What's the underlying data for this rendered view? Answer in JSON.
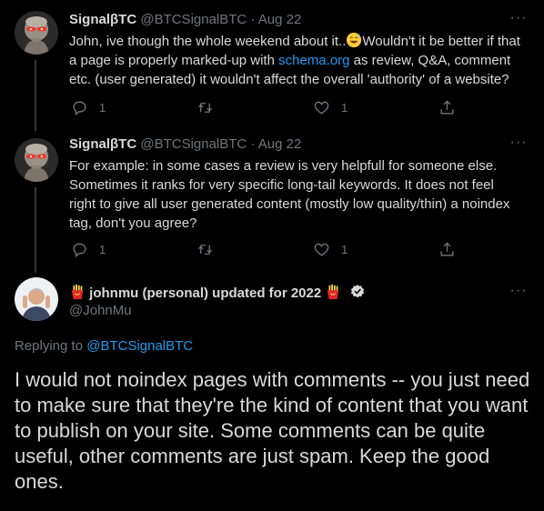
{
  "tweets": [
    {
      "name": "SignalβTC",
      "handle": "@BTCSignalBTC",
      "date": "Aug 22",
      "text_before_link": "John, ive though the whole weekend about it..",
      "text_after_emoji": "Wouldn't it be better if that a page is properly marked-up with ",
      "link_text": "schema.org",
      "text_after_link": " as review, Q&A, comment etc. (user generated) it wouldn't affect the overall 'authority' of a website?",
      "replies": "1",
      "likes": "1"
    },
    {
      "name": "SignalβTC",
      "handle": "@BTCSignalBTC",
      "date": "Aug 22",
      "text": "For example: in some cases a review is very helpfull for someone else. Sometimes it ranks for very specific long-tail keywords. It does not feel right to give all user generated content (mostly low quality/thin) a noindex tag, don't you agree?",
      "replies": "1",
      "likes": "1"
    }
  ],
  "main_tweet": {
    "name": "johnmu (personal) updated for 2022",
    "handle": "@JohnMu",
    "replying_prefix": "Replying to ",
    "replying_to": "@BTCSignalBTC",
    "text": "I would not noindex pages with comments -- you just need to make sure that they're the kind of content that you want to publish on your site. Some comments can be quite useful, other comments are just spam. Keep the good ones."
  },
  "separator": "·",
  "more_label": "···",
  "colors": {
    "background": "#000000",
    "text": "#d9d9d9",
    "secondary": "#6e767d",
    "link": "#1d9bf0",
    "verified": "#d9d9d9"
  },
  "icons": {
    "reply": "reply-icon",
    "retweet": "retweet-icon",
    "like": "heart-icon",
    "share": "share-icon",
    "more": "more-icon",
    "verified": "verified-badge-icon",
    "emoji": "grinning-sweat-emoji",
    "fries": "fries-emoji"
  }
}
